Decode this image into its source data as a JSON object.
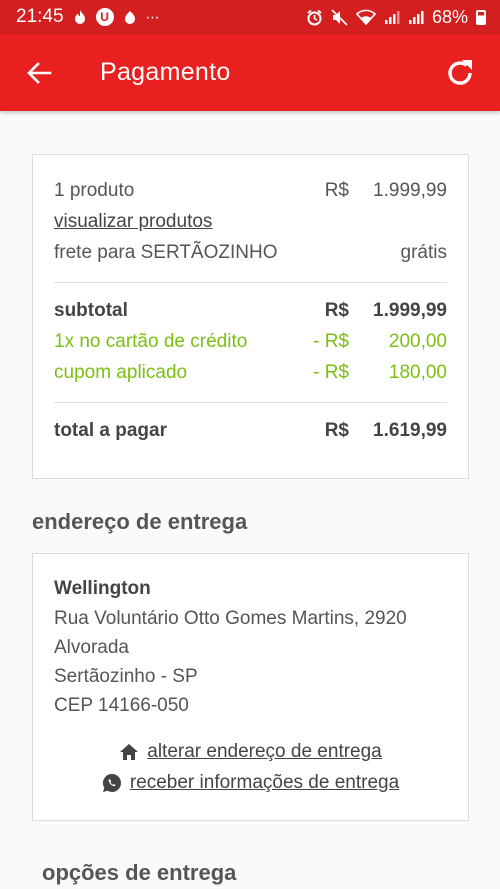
{
  "status_bar": {
    "time": "21:45",
    "battery": "68%"
  },
  "app_bar": {
    "title": "Pagamento"
  },
  "summary": {
    "products_label": "1 produto",
    "products_currency": "R$",
    "products_value": "1.999,99",
    "view_products_link": "visualizar produtos",
    "shipping_label": "frete para SERTÃOZINHO",
    "shipping_value": "grátis",
    "subtotal_label": "subtotal",
    "subtotal_currency": "R$",
    "subtotal_value": "1.999,99",
    "credit_label": "1x no cartão de crédito",
    "credit_currency": "- R$",
    "credit_value": "200,00",
    "coupon_label": "cupom aplicado",
    "coupon_currency": "- R$",
    "coupon_value": "180,00",
    "total_label": "total a pagar",
    "total_currency": "R$",
    "total_value": "1.619,99"
  },
  "address_section": {
    "title": "endereço de entrega",
    "name": "Wellington",
    "street": "Rua Voluntário Otto Gomes Martins, 2920",
    "neighborhood": "Alvorada",
    "city": "Sertãozinho - SP",
    "zip": "CEP 14166-050",
    "change_address_link": "alterar endereço de entrega",
    "receive_info_link": "receber informações de entrega"
  },
  "delivery_section": {
    "title": "opções de entrega"
  },
  "colors": {
    "primary": "#e8201f",
    "status_bar": "#d31f1f",
    "discount": "#7cbf12"
  }
}
